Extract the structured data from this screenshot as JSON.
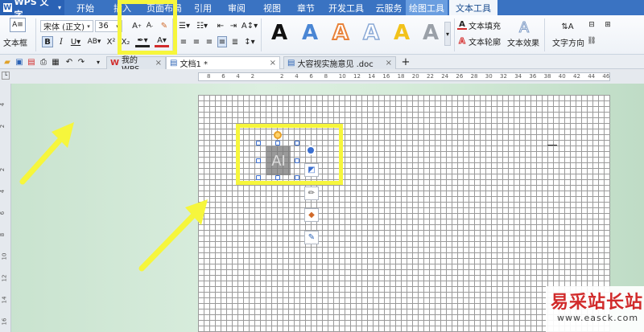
{
  "app": {
    "name": "WPS 文字",
    "logo_letter": "W"
  },
  "menu": {
    "items": [
      "开始",
      "插入",
      "页面布局",
      "引用",
      "审阅",
      "视图",
      "章节",
      "开发工具",
      "云服务",
      "绘图工具",
      "文本工具"
    ],
    "context_tabs": [
      "绘图工具",
      "文本工具"
    ],
    "active": "文本工具"
  },
  "ribbon": {
    "textbox_label": "文本框",
    "font_name": "宋体 (正文)",
    "font_size": "36",
    "wordart_styles_colors": [
      "#111111",
      "#4a86d4",
      "#e8823a",
      "#8aa9d6",
      "#f2c21b",
      "#9aa0a8"
    ],
    "text_fill_label": "文本填充",
    "text_outline_label": "文本轮廓",
    "text_effect_label": "文本效果",
    "text_direction_label": "文字方向"
  },
  "tabs": {
    "items": [
      {
        "label": "我的WPS",
        "icon": "wps-logo-icon",
        "closable": true,
        "active": false
      },
      {
        "label": "文档1 *",
        "icon": "doc-icon",
        "closable": true,
        "active": true
      },
      {
        "label": "大容视实施意见 .doc",
        "icon": "doc-icon",
        "closable": true,
        "active": false
      }
    ],
    "add_label": "+"
  },
  "ruler": {
    "h_ticks": [
      "8",
      "6",
      "4",
      "2",
      "",
      "2",
      "4",
      "6",
      "8",
      "10",
      "12",
      "14",
      "16",
      "18",
      "20",
      "22",
      "24",
      "26",
      "28",
      "30",
      "32",
      "34",
      "36",
      "38",
      "40",
      "42",
      "44",
      "46"
    ],
    "v_ticks": [
      "4",
      "2",
      "",
      "2",
      "4",
      "6",
      "8",
      "10",
      "12",
      "14",
      "16"
    ]
  },
  "document": {
    "textbox_text": "AI"
  },
  "watermark": {
    "title": "易采站长站",
    "url": "www.easck.com"
  },
  "colors": {
    "menubar": "#3a73c2",
    "highlight": "#f6f63c",
    "arrow": "#f6f63c",
    "canvas_bg": "#d3ead8"
  }
}
